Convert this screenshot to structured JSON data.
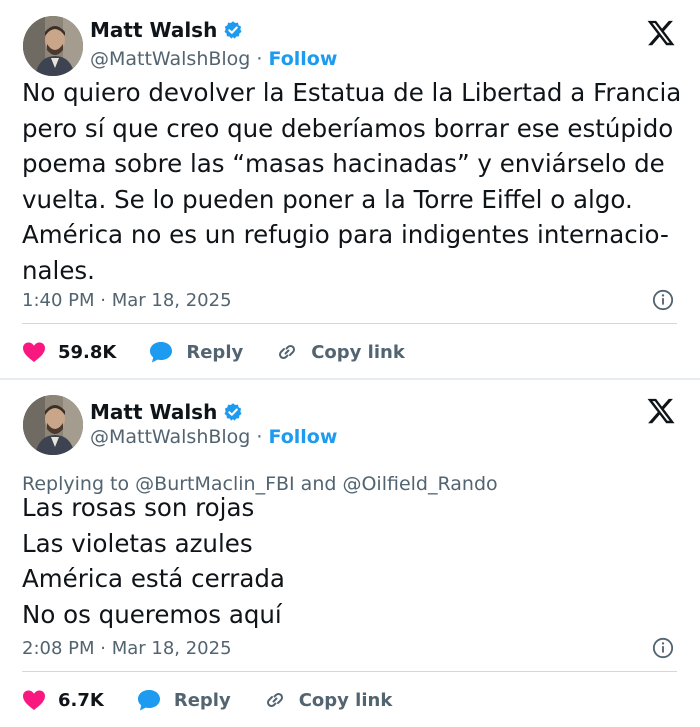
{
  "tweets": [
    {
      "author": {
        "name": "Matt Walsh",
        "handle": "@MattWalshBlog",
        "separator": " · ",
        "follow_label": "Follow"
      },
      "replying_to": "",
      "text": "No quiero devolver la Estatua de la Libertad a Francia\npero sí que creo que deberíamos borrar ese estúpido\npoema sobre las “masas hacinadas” y enviárselo de\nvuelta. Se lo pueden poner a la Torre Eiffel o algo.\nAmérica no es un refugio para indigentes internacio-\nnales.",
      "timestamp": "1:40 PM · Mar 18, 2025",
      "likes": "59.8K",
      "reply_label": "Reply",
      "copy_link_label": "Copy link"
    },
    {
      "author": {
        "name": "Matt Walsh",
        "handle": "@MattWalshBlog",
        "separator": " · ",
        "follow_label": "Follow"
      },
      "replying_to": "Replying to @BurtMaclin_FBI and @Oilfield_Rando",
      "text": "Las rosas son rojas\nLas violetas azules\nAmérica está cerrada\nNo os queremos aquí",
      "timestamp": "2:08 PM · Mar 18, 2025",
      "likes": "6.7K",
      "reply_label": "Reply",
      "copy_link_label": "Copy link"
    }
  ],
  "colors": {
    "accent": "#1d9bf0",
    "like": "#f91880",
    "text": "#0f1419",
    "muted": "#536471"
  },
  "icons": [
    "verified-badge-icon",
    "x-logo-icon",
    "info-icon",
    "heart-icon",
    "reply-bubble-icon",
    "link-icon"
  ]
}
